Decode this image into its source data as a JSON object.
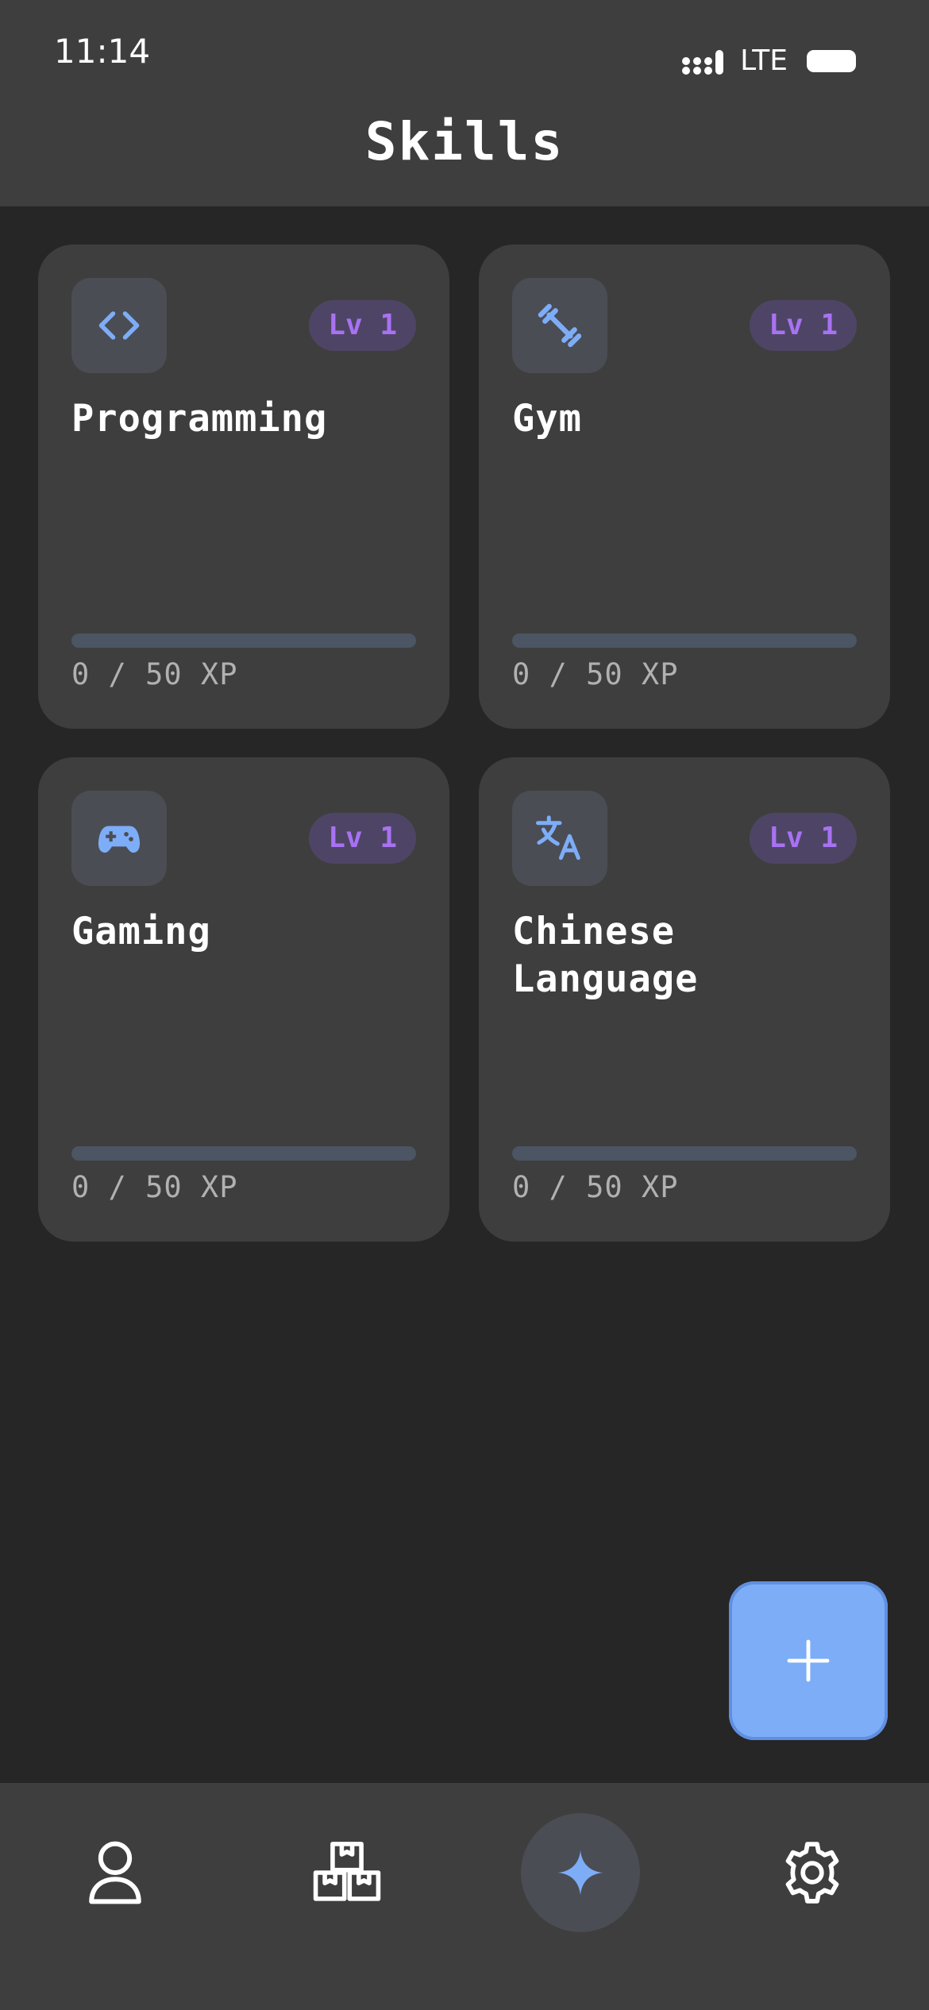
{
  "status_bar": {
    "time": "11:14",
    "network": "LTE"
  },
  "header": {
    "title": "Skills"
  },
  "colors": {
    "accent": "#7eadf8",
    "level_text": "#a872f2",
    "level_bg": "#4e4566",
    "card_bg": "#3e3e3e",
    "page_bg": "#262626"
  },
  "skills": [
    {
      "name": "Programming",
      "icon": "code-icon",
      "level": "Lv 1",
      "xp_text": "0 / 50 XP",
      "progress": 0
    },
    {
      "name": "Gym",
      "icon": "dumbbell-icon",
      "level": "Lv 1",
      "xp_text": "0 / 50 XP",
      "progress": 0
    },
    {
      "name": "Gaming",
      "icon": "gamepad-icon",
      "level": "Lv 1",
      "xp_text": "0 / 50 XP",
      "progress": 0
    },
    {
      "name": "Chinese Language",
      "icon": "translate-icon",
      "level": "Lv 1",
      "xp_text": "0 / 50 XP",
      "progress": 0
    }
  ],
  "fab": {
    "icon": "plus-icon"
  },
  "bottom_nav": [
    {
      "icon": "profile-icon",
      "active": false
    },
    {
      "icon": "boxes-icon",
      "active": false
    },
    {
      "icon": "sparkle-icon",
      "active": true
    },
    {
      "icon": "gear-icon",
      "active": false
    }
  ]
}
